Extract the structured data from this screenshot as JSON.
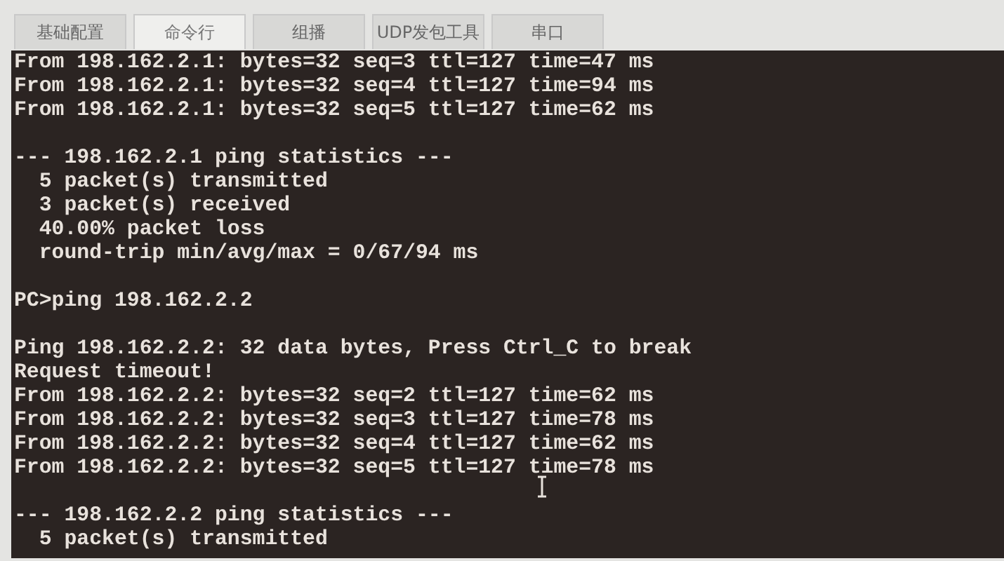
{
  "tabs": [
    {
      "label": "基础配置",
      "selected": false
    },
    {
      "label": "命令行",
      "selected": true
    },
    {
      "label": "组播",
      "selected": false
    },
    {
      "label": "UDP发包工具",
      "selected": false
    },
    {
      "label": "串口",
      "selected": false
    }
  ],
  "terminal": {
    "lines": [
      {
        "kind": "text",
        "text": "From 198.162.2.1: bytes=32 seq=3 ttl=127 time=47 ms"
      },
      {
        "kind": "text",
        "text": "From 198.162.2.1: bytes=32 seq=4 ttl=127 time=94 ms"
      },
      {
        "kind": "text",
        "text": "From 198.162.2.1: bytes=32 seq=5 ttl=127 time=62 ms"
      },
      {
        "kind": "blank"
      },
      {
        "kind": "text",
        "text": "--- 198.162.2.1 ping statistics ---"
      },
      {
        "kind": "text",
        "text": "  5 packet(s) transmitted"
      },
      {
        "kind": "text",
        "text": "  3 packet(s) received"
      },
      {
        "kind": "text",
        "text": "  40.00% packet loss"
      },
      {
        "kind": "text",
        "text": "  round-trip min/avg/max = 0/67/94 ms"
      },
      {
        "kind": "blank"
      },
      {
        "kind": "text",
        "text": "PC>ping 198.162.2.2"
      },
      {
        "kind": "blank"
      },
      {
        "kind": "text",
        "text": "Ping 198.162.2.2: 32 data bytes, Press Ctrl_C to break"
      },
      {
        "kind": "text",
        "text": "Request timeout!"
      },
      {
        "kind": "text",
        "text": "From 198.162.2.2: bytes=32 seq=2 ttl=127 time=62 ms"
      },
      {
        "kind": "text",
        "text": "From 198.162.2.2: bytes=32 seq=3 ttl=127 time=78 ms"
      },
      {
        "kind": "text",
        "text": "From 198.162.2.2: bytes=32 seq=4 ttl=127 time=62 ms"
      },
      {
        "kind": "text",
        "text": "From 198.162.2.2: bytes=32 seq=5 ttl=127 time=78 ms"
      },
      {
        "kind": "blank"
      },
      {
        "kind": "text",
        "text": "--- 198.162.2.2 ping statistics ---"
      },
      {
        "kind": "text",
        "text": "  5 packet(s) transmitted"
      }
    ]
  }
}
